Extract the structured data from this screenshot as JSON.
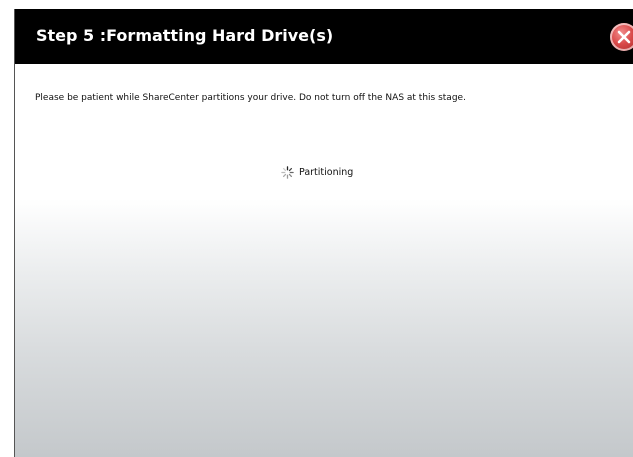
{
  "dialog": {
    "title": "Step 5 :Formatting Hard Drive(s)",
    "message": "Please be patient while ShareCenter partitions your drive. Do not turn off the NAS at this stage.",
    "status_label": "Partitioning",
    "close_icon": "close-icon",
    "spinner_icon": "spinner-icon"
  },
  "colors": {
    "titlebar_bg": "#000000",
    "title_text": "#ffffff",
    "close_button": "#d94a4a"
  }
}
